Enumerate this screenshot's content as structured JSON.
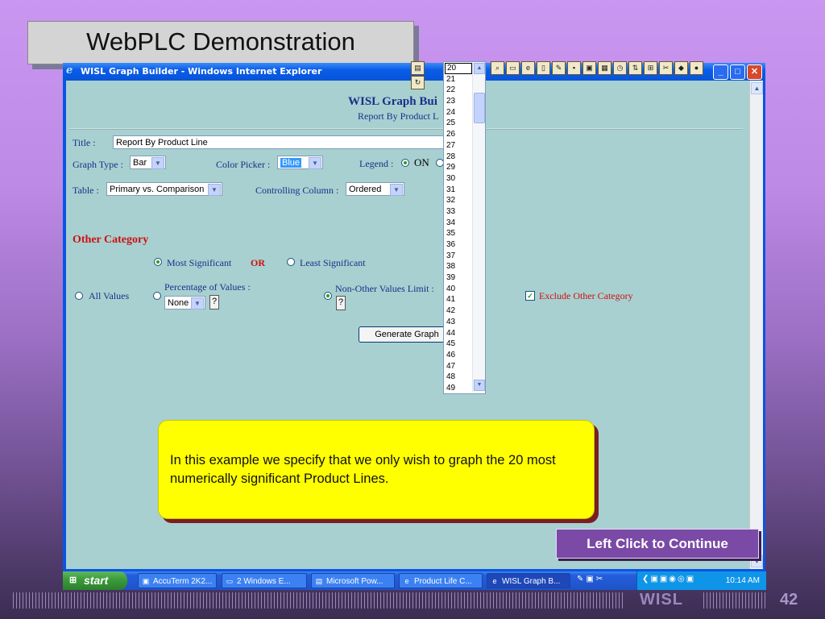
{
  "slide": {
    "title": "WebPLC Demonstration",
    "footer_brand": "WISL",
    "page_number": "42"
  },
  "window": {
    "title": "WISL Graph Builder - Windows Internet Explorer"
  },
  "form": {
    "heading": "WISL Graph Bui",
    "subheading": "Report By Product L",
    "title_label": "Title :",
    "title_value": "Report By Product Line",
    "graph_type_label": "Graph Type :",
    "graph_type_value": "Bar",
    "color_picker_label": "Color Picker :",
    "color_value": "Blue",
    "legend_label": "Legend :",
    "legend_on": "ON",
    "table_label": "Table :",
    "table_value": "Primary vs. Comparison",
    "controlling_label": "Controlling Column :",
    "controlling_value": "Ordered",
    "other_category_heading": "Other Category",
    "most_significant": "Most Significant",
    "or_label": "OR",
    "least_significant": "Least Significant",
    "all_values": "All Values",
    "percentage_label": "Percentage of Values :",
    "percentage_value": "None",
    "non_other_label": "Non-Other Values Limit :",
    "help": "?",
    "exclude_other": "Exclude Other Category",
    "generate_button": "Generate Graph",
    "accent_red": "#cc1111",
    "label_blue": "#1a2f8a"
  },
  "dropdown_list": {
    "items": [
      "20",
      "21",
      "22",
      "23",
      "24",
      "25",
      "26",
      "27",
      "28",
      "29",
      "30",
      "31",
      "32",
      "33",
      "34",
      "35",
      "36",
      "37",
      "38",
      "39",
      "40",
      "41",
      "42",
      "43",
      "44",
      "45",
      "46",
      "47",
      "48",
      "49"
    ],
    "selected": "20"
  },
  "taskbar": {
    "start": "start",
    "tasks": [
      "AccuTerm 2K2...",
      "2 Windows E...",
      "Microsoft Pow...",
      "Product Life C...",
      "WISL Graph B..."
    ],
    "clock": "10:14 AM"
  },
  "callout": {
    "text": "In this example we specify that we only wish to graph the 20 most numerically significant Product Lines."
  },
  "continue_button": {
    "label": "Left Click to Continue"
  }
}
